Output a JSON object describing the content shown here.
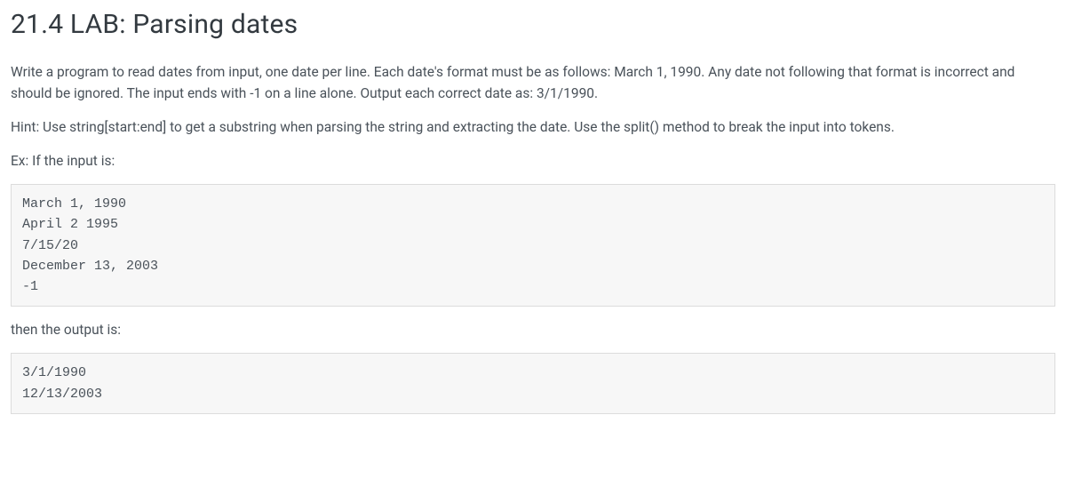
{
  "title": "21.4 LAB: Parsing dates",
  "para1": "Write a program to read dates from input, one date per line. Each date's format must be as follows: March 1, 1990. Any date not following that format is incorrect and should be ignored. The input ends with -1 on a line alone. Output each correct date as: 3/1/1990.",
  "para2": "Hint: Use string[start:end] to get a substring when parsing the string and extracting the date. Use the split() method to break the input into tokens.",
  "para3": "Ex: If the input is:",
  "code1": "March 1, 1990\nApril 2 1995\n7/15/20\nDecember 13, 2003\n-1",
  "para4": "then the output is:",
  "code2": "3/1/1990\n12/13/2003"
}
